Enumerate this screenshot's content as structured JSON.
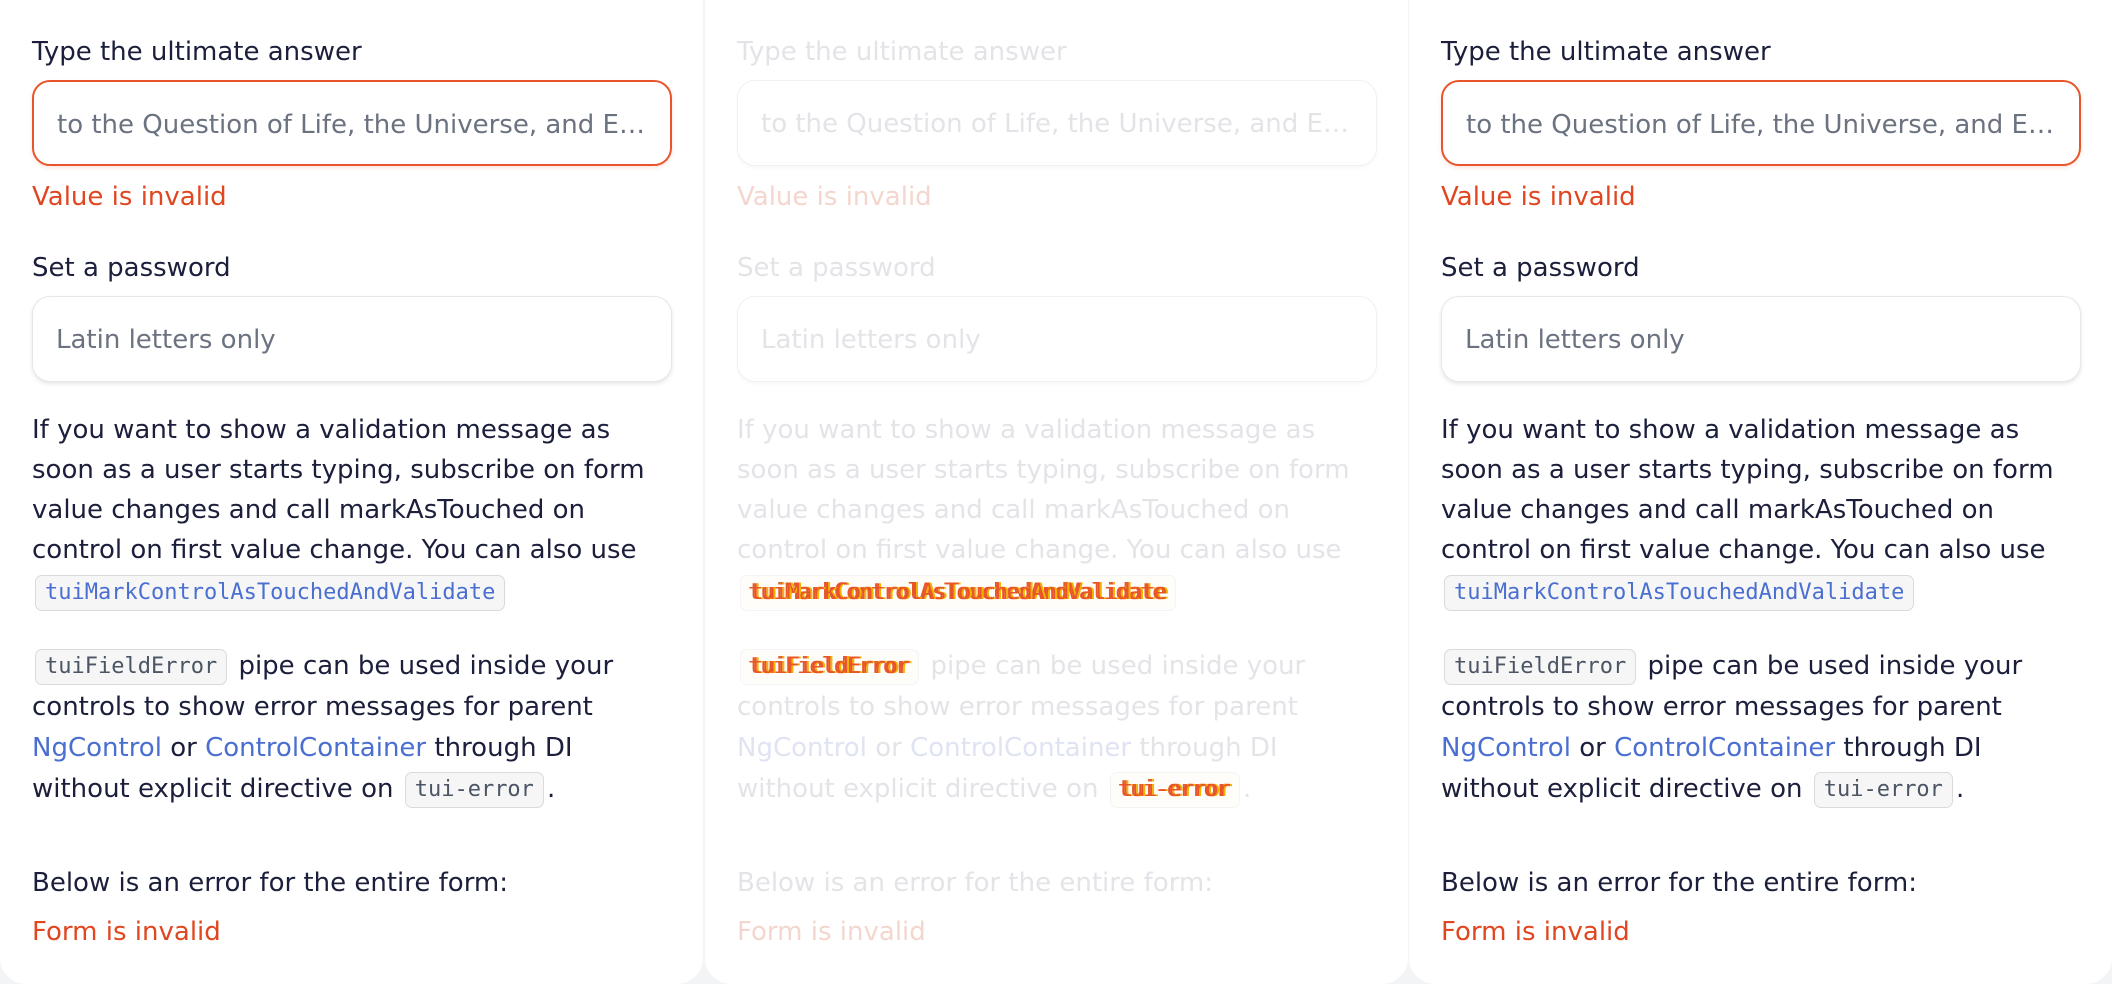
{
  "form": {
    "answer_label": "Type the ultimate answer",
    "answer_placeholder": "to the Question of Life, the Universe, and Everything",
    "answer_error": "Value is invalid",
    "password_label": "Set a password",
    "password_placeholder": "Latin letters only",
    "form_error": "Form is invalid"
  },
  "paragraph1": {
    "text": "If you want to show a validation message as soon as a user starts typing, subscribe on form value changes and call markAsTouched on control on first value change. You can also use",
    "code": "tuiMarkControlAsTouchedAndValidate"
  },
  "paragraph2": {
    "code_pipe": "tuiFieldError",
    "text_pipe": "pipe can be used inside your controls to show error messages for parent",
    "link_ngcontrol": "NgControl",
    "text_or": "or",
    "link_controlcontainer": "ControlContainer",
    "text_through": "through DI without explicit directive on",
    "code_tag": "tui-error",
    "text_end": "."
  },
  "paragraph3": {
    "text": "Below is an error for the entire form:"
  },
  "colors": {
    "error": "#e0461f",
    "link": "#4a6fd0",
    "text": "#1b1f3b"
  }
}
